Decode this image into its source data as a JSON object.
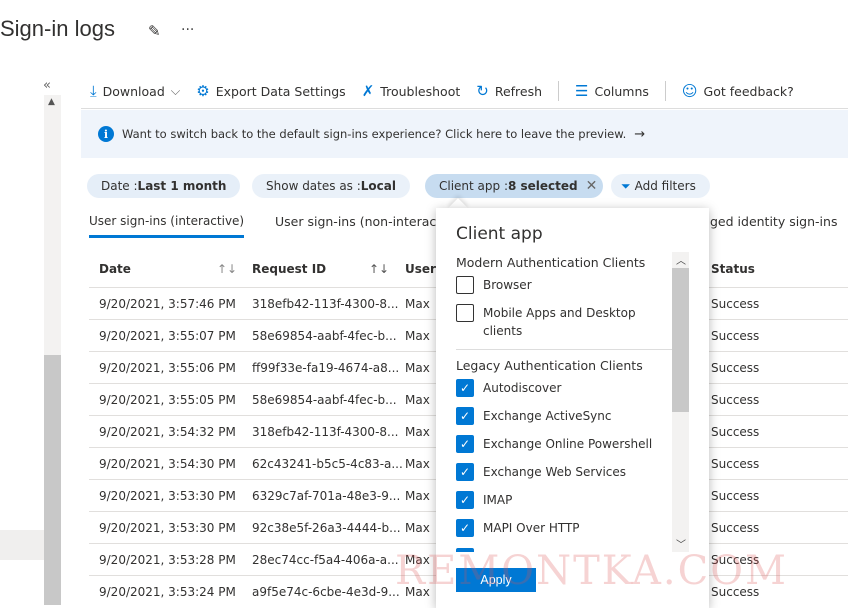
{
  "header": {
    "title": "Sign-in logs",
    "pin_icon": "pin-icon",
    "more": "···"
  },
  "toolbar": {
    "download": "Download",
    "export": "Export Data Settings",
    "troubleshoot": "Troubleshoot",
    "refresh": "Refresh",
    "columns": "Columns",
    "feedback": "Got feedback?"
  },
  "banner": {
    "text": "Want to switch back to the default sign-ins experience? Click here to leave the preview.",
    "arrow": "→"
  },
  "filters": [
    {
      "label": "Date : ",
      "value": "Last 1 month"
    },
    {
      "label": "Show dates as : ",
      "value": "Local"
    },
    {
      "label": "Client app : ",
      "value": "8 selected"
    },
    {
      "label": "Add filters"
    }
  ],
  "tabs": [
    "User sign-ins (interactive)",
    "User sign-ins (non-interac",
    "ged identity sign-ins"
  ],
  "table": {
    "headers": [
      "Date",
      "Request ID",
      "User",
      "Status"
    ],
    "rows": [
      [
        "9/20/2021, 3:57:46 PM",
        "318efb42-113f-4300-8...",
        "Max",
        "Success"
      ],
      [
        "9/20/2021, 3:55:07 PM",
        "58e69854-aabf-4fec-b...",
        "Max",
        "Success"
      ],
      [
        "9/20/2021, 3:55:06 PM",
        "ff99f33e-fa19-4674-a8...",
        "Max",
        "Success"
      ],
      [
        "9/20/2021, 3:55:05 PM",
        "58e69854-aabf-4fec-b...",
        "Max",
        "Success"
      ],
      [
        "9/20/2021, 3:54:32 PM",
        "318efb42-113f-4300-8...",
        "Max",
        "Success"
      ],
      [
        "9/20/2021, 3:54:30 PM",
        "62c43241-b5c5-4c83-a...",
        "Max",
        "Success"
      ],
      [
        "9/20/2021, 3:53:30 PM",
        "6329c7af-701a-48e3-9...",
        "Max",
        "Success"
      ],
      [
        "9/20/2021, 3:53:30 PM",
        "92c38e5f-26a3-4444-b...",
        "Max",
        "Success"
      ],
      [
        "9/20/2021, 3:53:28 PM",
        "28ec74cc-f5a4-406a-a...",
        "Max",
        "Success"
      ],
      [
        "9/20/2021, 3:53:24 PM",
        "a9f5e74c-6cbe-4e3d-9...",
        "Max",
        "Success"
      ]
    ]
  },
  "popup": {
    "title": "Client app",
    "group1": "Modern Authentication Clients",
    "group1_options": [
      {
        "label": "Browser",
        "checked": false
      },
      {
        "label": "Mobile Apps and Desktop clients",
        "checked": false
      }
    ],
    "group2": "Legacy Authentication Clients",
    "group2_options": [
      {
        "label": "Autodiscover",
        "checked": true
      },
      {
        "label": "Exchange ActiveSync",
        "checked": true
      },
      {
        "label": "Exchange Online Powershell",
        "checked": true
      },
      {
        "label": "Exchange Web Services",
        "checked": true
      },
      {
        "label": "IMAP",
        "checked": true
      },
      {
        "label": "MAPI Over HTTP",
        "checked": true
      }
    ],
    "apply": "Apply"
  },
  "watermark": "REMONTKA.COM",
  "colors": {
    "accent": "#0078d4",
    "pill": "#e5eef8",
    "banner": "#eff4fb"
  }
}
